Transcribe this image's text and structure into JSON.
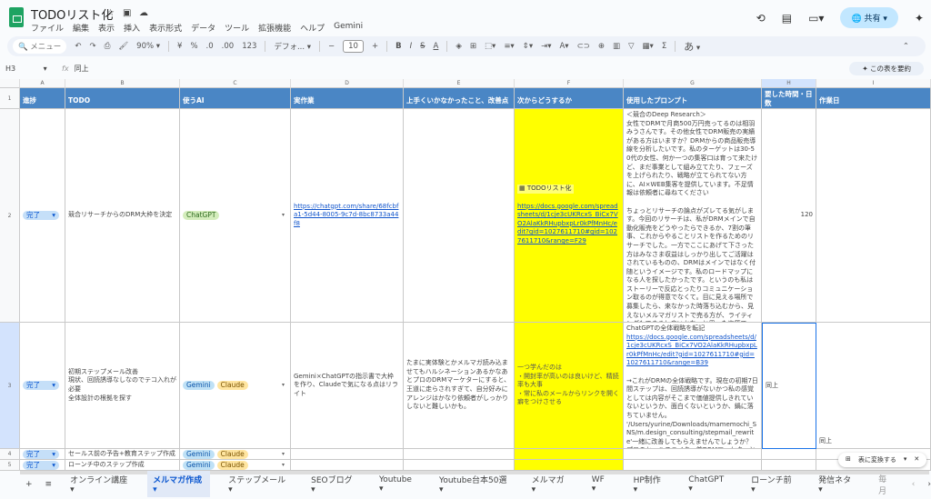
{
  "app": {
    "title": "TODOリスト化",
    "menu": [
      "ファイル",
      "編集",
      "表示",
      "挿入",
      "表示形式",
      "データ",
      "ツール",
      "拡張機能",
      "ヘルプ",
      "Gemini"
    ],
    "share": "共有"
  },
  "toolbar": {
    "search": "メニュー",
    "zoom": "90%",
    "currency": "¥",
    "percent": "%",
    "dec_minus": ".0",
    "dec_plus": ".00",
    "number": "123",
    "font": "デフォ...",
    "font_size": "10",
    "bold": "B",
    "italic": "I",
    "strike": "S",
    "text_color": "A",
    "ime": "あ"
  },
  "formula": {
    "cell_ref": "H3",
    "fx": "fx",
    "value": "同上",
    "summarize": "この表を要約"
  },
  "columns": [
    "A",
    "B",
    "C",
    "D",
    "E",
    "F",
    "G",
    "H",
    "I"
  ],
  "headers": [
    "進捗",
    "TODO",
    "使うAI",
    "実作業",
    "上手くいかなかったこと、改善点",
    "次からどうするか",
    "使用したプロンプト",
    "要した時間・日数",
    "作業日"
  ],
  "rows": [
    {
      "num": "2",
      "status": "完了",
      "todo": "競合リサーチからのDRM大枠を決定",
      "ai": [
        "ChatGPT"
      ],
      "work_link": "https://chatgpt.com/share/68fcbfa1-5d44-8005-9c7d-8bc8733a44f8",
      "issues": "",
      "next_chip": "TODOリスト化",
      "next_link": "https://docs.google.com/spreadsheets/d/1cje3cUKRcxS_BiCx7VO2AlaKkRHupbxpLr0kPfMnHc/edit?gid=1027611710#gid=1027611710&range=F29",
      "prompt": "＜競合のDeep Research＞\n女性でDRMで月商500万円売ってるのは相羽みうさんです。その他女性でDRM販売の実績がある方はいますか？DRMからの商品販売導線を分析したいです。私のターゲットは30-50代の女性、何か一つの集客口は育って来たけど、まだ事業として組み立てたり、フェーズを上げられたり、戦略が立てられてない方に、AI×WEB集客を提供しています。不足情報は依頼者に尋ねてください\n\nちょっとリサーチの論点がズレてる気がします。今回のリサーチは、私がDRMメインで自動化販売をどうやったらできるか、7割の筆事、これからやることリストを作るためのリサーチでした。一方でここにあげて下さった方はみなさま収益はしっかり出してご活躍はされているものの、DRMはメインではなく付随というイメージです。私のロードマップになる人を探したかったです。というのも私はストーリーで反応とったりコミュニケーション取るのが得意でなくて。目に見える場所で募集したら、来なかった時落ち込むから、見えないメルマガリストで売る方が、ライティングもできるし良いかなーと思った次第です。いつまでもセールスかけません。私は放っておくと。",
      "time": "120",
      "date": ""
    },
    {
      "num": "3",
      "status": "完了",
      "todo": "初期ステップメール改善\n現状、回読誘導なしなのでテコ入れが必要\n全体設計の根拠を探す",
      "ai": [
        "Gemini",
        "Claude"
      ],
      "work": "Gemini×ChatGPTの指示書で大枠を作り、Claudeで気になる点はリライト",
      "issues": "たまに実体験とかメルマガ読み込ませてもハルシネーションあるかなあとプロのDRMマーケターにすると、王道に走らされすぎて、自分好みにアレンジはかなり依頼者がしっかりしないと難しいかも。",
      "next": "一つ学んだのは\n・開封率が高いのは良いけど、精読率も大事\n・常に私のメールからリンクを開く癖をつけさせる",
      "prompt_head": "ChatGPTの全体戦略を転記",
      "prompt_link": "https://docs.google.com/spreadsheets/d/1cje3cUKRcxS_BiCx7VO2AlaKkRHupbxpLr0kPfMnHc/edit?gid=1027611710#gid=1027611710&range=B39",
      "prompt_body": "→これがDRMの全体戦略です。現在の初期7日間ステップは、回読誘導がないかつ私の感覚としては内容がそこまで価値提供しきれていないというか、面白くないというか、鍋に落ちていません。\n'/Users/yurine/Downloads/mamemochi_SNS/m.design_consulting/stepmail_rewrite'一緒に改善してもらえませんでしょうか？プロのセールスライター兼DRMマーケターとして全力でお願いします。",
      "time": "同上",
      "date": "同上"
    },
    {
      "num": "4",
      "status": "完了",
      "todo": "セールス前の予告+教育ステップ作成",
      "ai": [
        "Gemini",
        "Claude"
      ]
    },
    {
      "num": "5",
      "status": "完了",
      "todo": "ローンチ中のステップ作成",
      "ai": [
        "Gemini",
        "Claude"
      ]
    }
  ],
  "row1_num": "1",
  "convert": "表に変換する",
  "tabs": [
    "オンライン講座",
    "メルマガ作成",
    "ステップメール",
    "SEOブログ",
    "Youtube",
    "Youtube台本50選",
    "メルマガ",
    "WF",
    "HP制作",
    "ChatGPT",
    "ローンチ前",
    "発信ネタ",
    "毎月"
  ],
  "active_tab": "メルマガ作成",
  "colors": {
    "header": "#4a86c5",
    "highlight": "#ffff00",
    "status_chip": "#c5dff8",
    "chatgpt_chip": "#d4edbc",
    "gemini_chip": "#bfe1f6",
    "claude_chip": "#ffe5a0"
  }
}
